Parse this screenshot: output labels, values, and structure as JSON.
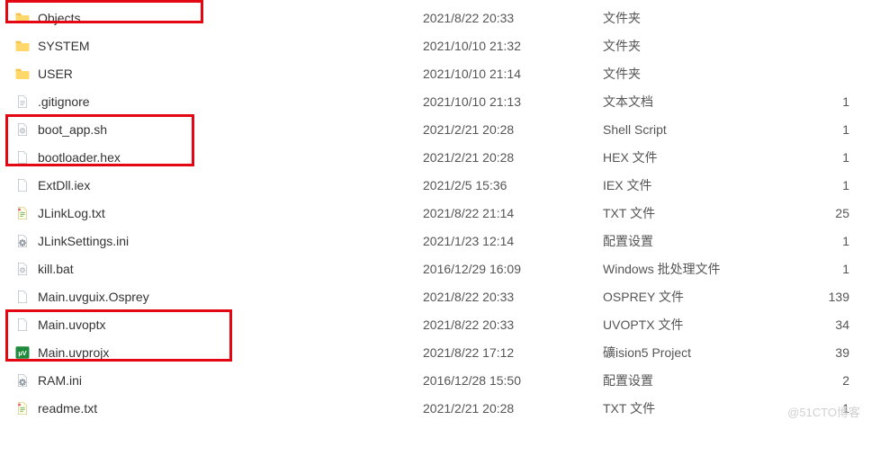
{
  "files": [
    {
      "icon": "folder",
      "name": "Objects",
      "date": "2021/8/22 20:33",
      "type": "文件夹",
      "size": ""
    },
    {
      "icon": "folder",
      "name": "SYSTEM",
      "date": "2021/10/10 21:32",
      "type": "文件夹",
      "size": ""
    },
    {
      "icon": "folder",
      "name": "USER",
      "date": "2021/10/10 21:14",
      "type": "文件夹",
      "size": ""
    },
    {
      "icon": "txtgray",
      "name": ".gitignore",
      "date": "2021/10/10 21:13",
      "type": "文本文档",
      "size": "1"
    },
    {
      "icon": "gear",
      "name": "boot_app.sh",
      "date": "2021/2/21 20:28",
      "type": "Shell Script",
      "size": "1"
    },
    {
      "icon": "blank",
      "name": "bootloader.hex",
      "date": "2021/2/21 20:28",
      "type": "HEX 文件",
      "size": "1"
    },
    {
      "icon": "blank",
      "name": "ExtDll.iex",
      "date": "2021/2/5 15:36",
      "type": "IEX 文件",
      "size": "1"
    },
    {
      "icon": "txtnote",
      "name": "JLinkLog.txt",
      "date": "2021/8/22 21:14",
      "type": "TXT 文件",
      "size": "25"
    },
    {
      "icon": "ini",
      "name": "JLinkSettings.ini",
      "date": "2021/1/23 12:14",
      "type": "配置设置",
      "size": "1"
    },
    {
      "icon": "gear",
      "name": "kill.bat",
      "date": "2016/12/29 16:09",
      "type": "Windows 批处理文件",
      "size": "1"
    },
    {
      "icon": "blank",
      "name": "Main.uvguix.Osprey",
      "date": "2021/8/22 20:33",
      "type": "OSPREY 文件",
      "size": "139"
    },
    {
      "icon": "blank",
      "name": "Main.uvoptx",
      "date": "2021/8/22 20:33",
      "type": "UVOPTX 文件",
      "size": "34"
    },
    {
      "icon": "uvproj",
      "name": "Main.uvprojx",
      "date": "2021/8/22 17:12",
      "type": "礦ision5 Project",
      "size": "39"
    },
    {
      "icon": "ini",
      "name": "RAM.ini",
      "date": "2016/12/28 15:50",
      "type": "配置设置",
      "size": "2"
    },
    {
      "icon": "txtnote",
      "name": "readme.txt",
      "date": "2021/2/21 20:28",
      "type": "TXT 文件",
      "size": "1"
    }
  ],
  "watermark": "@51CTO博客"
}
